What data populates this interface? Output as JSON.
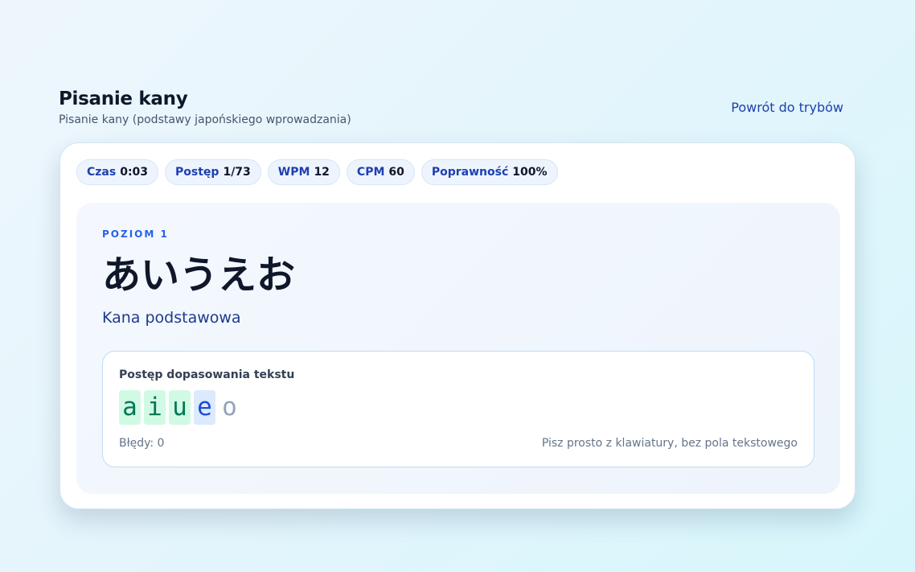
{
  "header": {
    "title": "Pisanie kany",
    "subtitle": "Pisanie kany (podstawy japońskiego wprowadzania)",
    "back_link": "Powrót do trybów"
  },
  "stats": [
    {
      "label": "Czas",
      "value": "0:03"
    },
    {
      "label": "Postęp",
      "value": "1/73"
    },
    {
      "label": "WPM",
      "value": "12"
    },
    {
      "label": "CPM",
      "value": "60"
    },
    {
      "label": "Poprawność",
      "value": "100%"
    }
  ],
  "level": {
    "label": "POZIOM 1",
    "kana": "あいうえお",
    "description": "Kana podstawowa"
  },
  "progress": {
    "title": "Postęp dopasowania tekstu",
    "chars": [
      {
        "char": "a",
        "state": "done"
      },
      {
        "char": "i",
        "state": "done"
      },
      {
        "char": "u",
        "state": "done"
      },
      {
        "char": "e",
        "state": "current"
      },
      {
        "char": "o",
        "state": "pending"
      }
    ],
    "errors": "Błędy: 0",
    "hint": "Pisz prosto z klawiatury, bez pola tekstowego"
  },
  "colors": {
    "accent": "#1e40af",
    "done_bg": "#d1fae5",
    "done_fg": "#047857",
    "current_bg": "#dbeafe",
    "current_fg": "#1d4ed8",
    "pending_fg": "#94a3b8"
  }
}
